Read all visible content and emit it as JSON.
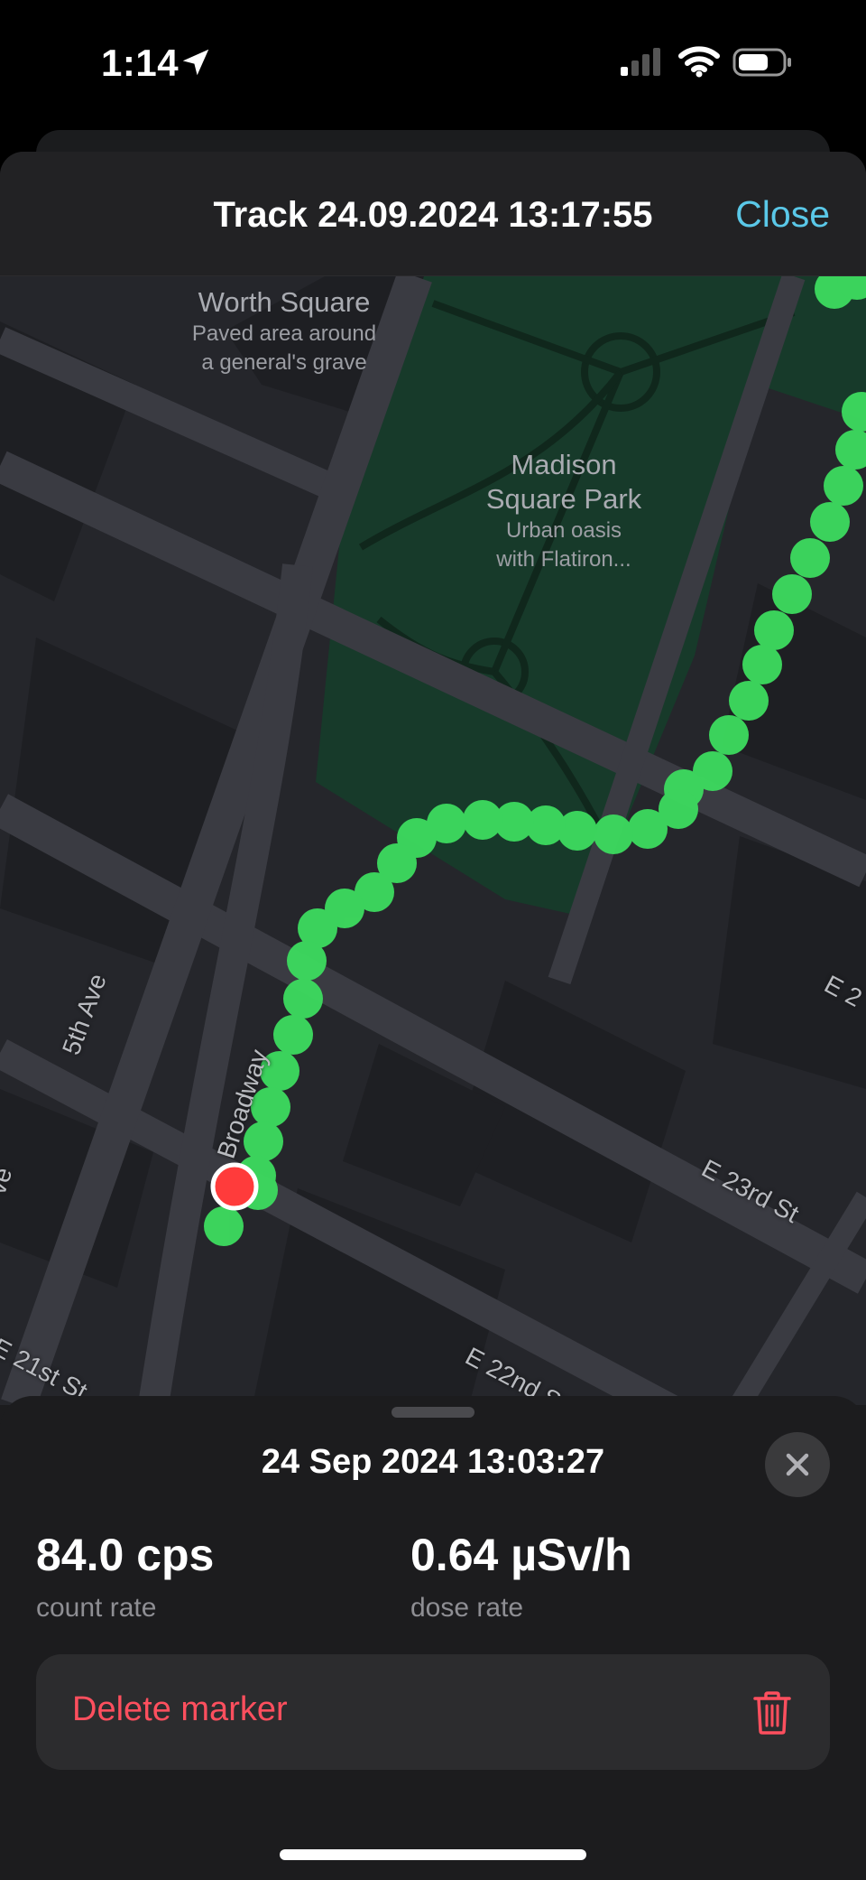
{
  "status_bar": {
    "time": "1:14",
    "icons": [
      "location-arrow-icon",
      "cellular-signal-icon",
      "wifi-icon",
      "battery-icon"
    ]
  },
  "header": {
    "title": "Track 24.09.2024 13:17:55",
    "close_label": "Close"
  },
  "map": {
    "pois": [
      {
        "title": "Worth Square",
        "subtitle_lines": [
          "Paved area around",
          "a general's grave"
        ]
      },
      {
        "title_lines": [
          "Madison",
          "Square Park"
        ],
        "subtitle_lines": [
          "Urban oasis",
          "with Flatiron..."
        ]
      }
    ],
    "streets": [
      "5th Ave",
      "Broadway",
      "E 23rd St",
      "E 22nd St",
      "E 21st St",
      "E 2",
      "ve"
    ],
    "track_color": "#3ddc5f",
    "marker_color": "#ff3b3b"
  },
  "marker": {
    "timestamp": "24 Sep 2024 13:03:27",
    "count_rate_value": "84.0 cps",
    "count_rate_label": "count rate",
    "dose_rate_value": "0.64 µSv/h",
    "dose_rate_label": "dose rate",
    "delete_label": "Delete marker"
  }
}
